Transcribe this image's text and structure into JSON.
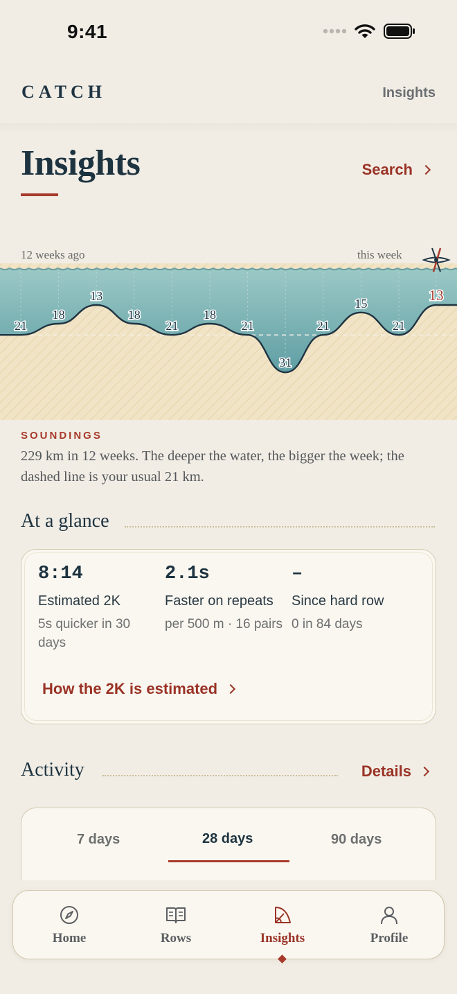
{
  "status_bar": {
    "time": "9:41"
  },
  "header": {
    "brand": "CATCH",
    "section_label": "Insights"
  },
  "page": {
    "title": "Insights",
    "search_label": "Search"
  },
  "soundings": {
    "range_start_label": "12 weeks ago",
    "range_end_label": "this week",
    "usual_km": 21,
    "weeks": [
      {
        "index": 1,
        "km": 21
      },
      {
        "index": 2,
        "km": 18
      },
      {
        "index": 3,
        "km": 13
      },
      {
        "index": 4,
        "km": 18
      },
      {
        "index": 5,
        "km": 21
      },
      {
        "index": 6,
        "km": 18
      },
      {
        "index": 7,
        "km": 21
      },
      {
        "index": 8,
        "km": 31
      },
      {
        "index": 9,
        "km": 21
      },
      {
        "index": 10,
        "km": 15
      },
      {
        "index": 11,
        "km": 21
      },
      {
        "index": 12,
        "km": 13,
        "current": true
      }
    ],
    "eyebrow": "SOUNDINGS",
    "caption": "229 km in 12 weeks. The deeper the water, the bigger the week; the dashed line is your usual 21 km."
  },
  "glance": {
    "title": "At a glance",
    "stats": [
      {
        "value": "8:14",
        "label": "Estimated 2K",
        "sub": "5s quicker in 30 days"
      },
      {
        "value": "2.1s",
        "label": "Faster on repeats",
        "sub": "per 500 m · 16 pairs"
      },
      {
        "value": "–",
        "label": "Since hard row",
        "sub": "0 in 84 days"
      }
    ],
    "link_label": "How the 2K is estimated"
  },
  "activity": {
    "title": "Activity",
    "details_label": "Details",
    "ranges": [
      "7 days",
      "28 days",
      "90 days"
    ],
    "selected_range": "28 days"
  },
  "tabbar": {
    "items": [
      {
        "label": "Home",
        "icon": "compass-icon"
      },
      {
        "label": "Rows",
        "icon": "book-icon"
      },
      {
        "label": "Insights",
        "icon": "chart-icon",
        "active": true
      },
      {
        "label": "Profile",
        "icon": "person-icon"
      }
    ]
  },
  "colors": {
    "accent": "#a83a2b",
    "water": "#7fb4b6",
    "sand": "#f1e3c4",
    "ink": "#1d3340"
  }
}
